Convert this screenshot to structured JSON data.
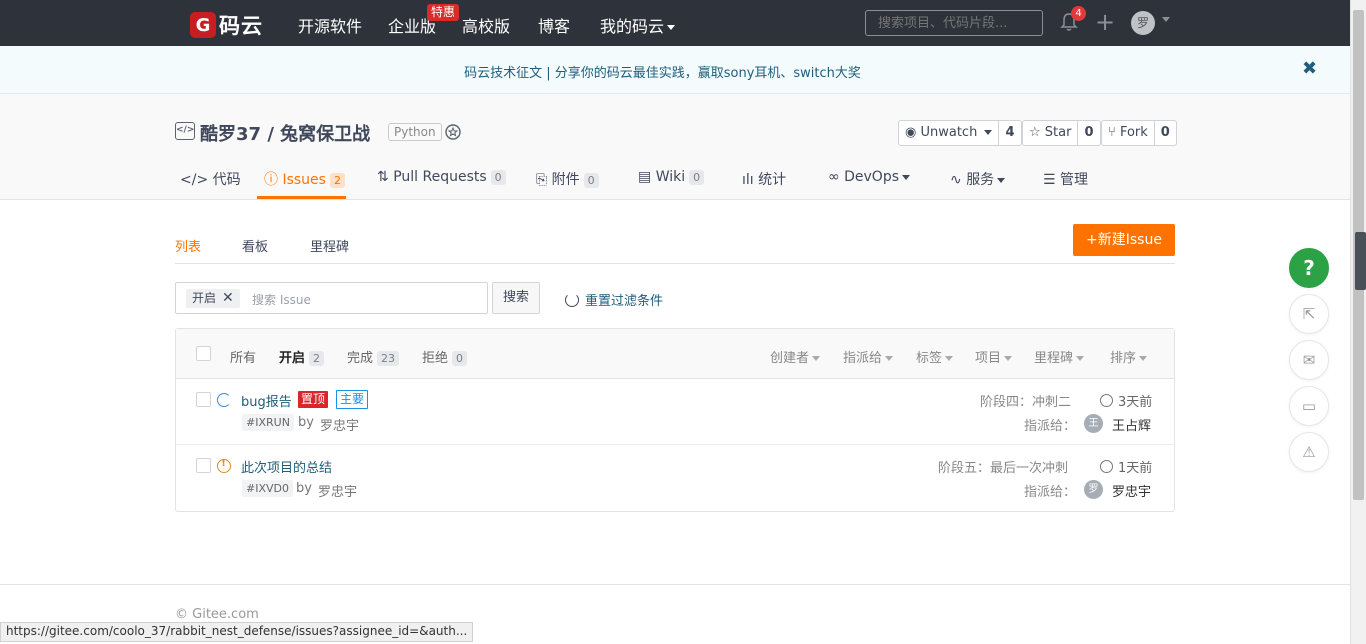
{
  "topnav": {
    "logo_mark": "G",
    "logo_text": "码云",
    "items": [
      "开源软件",
      "企业版",
      "高校版",
      "博客",
      "我的码云"
    ],
    "hot_badge": "特惠",
    "search_placeholder": "搜索项目、代码片段...",
    "notif_count": "4",
    "avatar_initial": "罗"
  },
  "banner": {
    "text": "码云技术征文 | 分享你的码云最佳实践，赢取sony耳机、switch大奖",
    "close": "✖"
  },
  "project": {
    "title": "酷罗37 / 兔窝保卫战",
    "language": "Python",
    "unwatch_label": "Unwatch",
    "unwatch_count": "4",
    "star_label": "Star",
    "star_count": "0",
    "fork_label": "Fork",
    "fork_count": "0"
  },
  "tabs": [
    {
      "label": "代码",
      "count": ""
    },
    {
      "label": "Issues",
      "count": "2"
    },
    {
      "label": "Pull Requests",
      "count": "0"
    },
    {
      "label": "附件",
      "count": "0"
    },
    {
      "label": "Wiki",
      "count": "0"
    },
    {
      "label": "统计",
      "count": ""
    },
    {
      "label": "DevOps",
      "count": ""
    },
    {
      "label": "服务",
      "count": ""
    },
    {
      "label": "管理",
      "count": ""
    }
  ],
  "subtabs": [
    "列表",
    "看板",
    "里程碑"
  ],
  "new_issue_label": "+新建Issue",
  "filter": {
    "tag": "开启",
    "placeholder": "搜索 Issue",
    "search_label": "搜索",
    "reset_label": "重置过滤条件"
  },
  "list_head": {
    "states": [
      {
        "label": "所有",
        "count": ""
      },
      {
        "label": "开启",
        "count": "2"
      },
      {
        "label": "完成",
        "count": "23"
      },
      {
        "label": "拒绝",
        "count": "0"
      }
    ],
    "filters": [
      "创建者",
      "指派给",
      "标签",
      "项目",
      "里程碑",
      "排序"
    ]
  },
  "issues": [
    {
      "title": "bug报告",
      "tag_top": "置顶",
      "tag_main": "主要",
      "number": "#IXRUN",
      "by": "by",
      "author": "罗忠宇",
      "stage": "阶段四：冲刺二",
      "time": "3天前",
      "assignee_label": "指派给：",
      "assignee_initial": "王",
      "assignee": "王占辉"
    },
    {
      "title": "此次项目的总结",
      "number": "#IXVD0",
      "by": "by",
      "author": "罗忠宇",
      "stage": "阶段五：最后一次冲刺",
      "time": "1天前",
      "assignee_label": "指派给：",
      "assignee_initial": "罗",
      "assignee": "罗忠宇"
    }
  ],
  "footer": "© Gitee.com",
  "statusbar": "https://gitee.com/coolo_37/rabbit_nest_defense/issues?assignee_id=&auth...",
  "float_help": "?",
  "colors": {
    "accent": "#fe7300",
    "nav_bg": "#2e323a",
    "link": "#1f5d7a",
    "help_green": "#2ba245",
    "top_tag_red": "#d9262b"
  }
}
